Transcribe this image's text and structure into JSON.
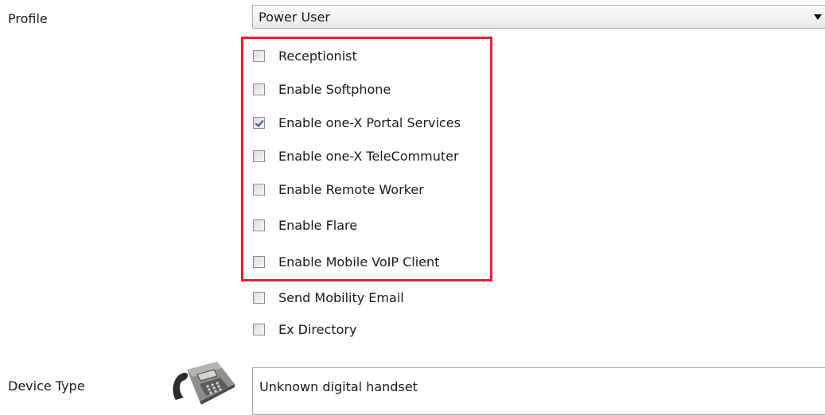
{
  "profile": {
    "label": "Profile",
    "selected": "Power User"
  },
  "checkboxes": [
    {
      "label": "Receptionist",
      "checked": false
    },
    {
      "label": "Enable Softphone",
      "checked": false
    },
    {
      "label": "Enable one-X Portal Services",
      "checked": true
    },
    {
      "label": "Enable one-X TeleCommuter",
      "checked": false
    },
    {
      "label": "Enable Remote Worker",
      "checked": false
    },
    {
      "label": "Enable Flare",
      "checked": false
    },
    {
      "label": "Enable Mobile VoIP Client",
      "checked": false
    },
    {
      "label": "Send Mobility Email",
      "checked": false
    },
    {
      "label": "Ex Directory",
      "checked": false
    }
  ],
  "device": {
    "label": "Device Type",
    "value": "Unknown digital handset",
    "icon": "desk-phone-icon"
  },
  "colors": {
    "highlight": "#e0222e",
    "check": "#2a4f9e"
  }
}
